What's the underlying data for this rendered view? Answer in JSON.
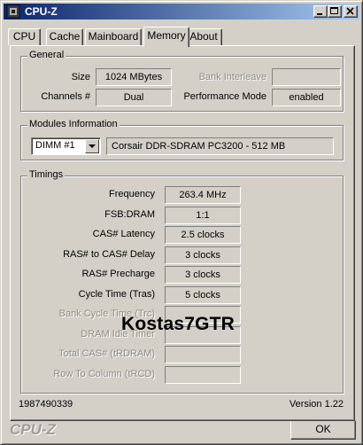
{
  "window": {
    "title": "CPU-Z"
  },
  "tabs": [
    {
      "label": "CPU"
    },
    {
      "label": "Cache"
    },
    {
      "label": "Mainboard"
    },
    {
      "label": "Memory",
      "active": true
    },
    {
      "label": "About"
    }
  ],
  "general": {
    "title": "General",
    "size_label": "Size",
    "size_value": "1024 MBytes",
    "channels_label": "Channels #",
    "channels_value": "Dual",
    "bank_interleave_label": "Bank Interleave",
    "bank_interleave_value": "",
    "performance_mode_label": "Performance Mode",
    "performance_mode_value": "enabled"
  },
  "modules": {
    "title": "Modules Information",
    "selected_dimm": "DIMM #1",
    "module_description": "Corsair DDR-SDRAM PC3200 - 512 MB"
  },
  "timings": {
    "title": "Timings",
    "rows": [
      {
        "label": "Frequency",
        "value": "263.4 MHz",
        "enabled": true
      },
      {
        "label": "FSB:DRAM",
        "value": "1:1",
        "enabled": true
      },
      {
        "label": "CAS# Latency",
        "value": "2.5 clocks",
        "enabled": true
      },
      {
        "label": "RAS# to CAS# Delay",
        "value": "3 clocks",
        "enabled": true
      },
      {
        "label": "RAS# Precharge",
        "value": "3 clocks",
        "enabled": true
      },
      {
        "label": "Cycle Time (Tras)",
        "value": "5 clocks",
        "enabled": true
      },
      {
        "label": "Bank Cycle Time (Trc)",
        "value": "",
        "enabled": false
      },
      {
        "label": "DRAM Idle Timer",
        "value": "",
        "enabled": false
      },
      {
        "label": "Total CAS# (tRDRAM)",
        "value": "",
        "enabled": false
      },
      {
        "label": "Row To Column (tRCD)",
        "value": "",
        "enabled": false
      }
    ]
  },
  "watermark": "Kostas7GTR",
  "footer": {
    "serial": "1987490339",
    "version": "Version 1.22",
    "brand": "CPU-Z",
    "ok_label": "OK"
  },
  "colors": {
    "face": "#d4d0c8",
    "title_gradient_start": "#0a246a",
    "title_gradient_end": "#a6caf0",
    "disabled_text": "#8f8b84"
  },
  "icons": [
    "cpu-z-app-icon",
    "minimize-icon",
    "maximize-icon",
    "close-icon",
    "dropdown-arrow-icon"
  ]
}
